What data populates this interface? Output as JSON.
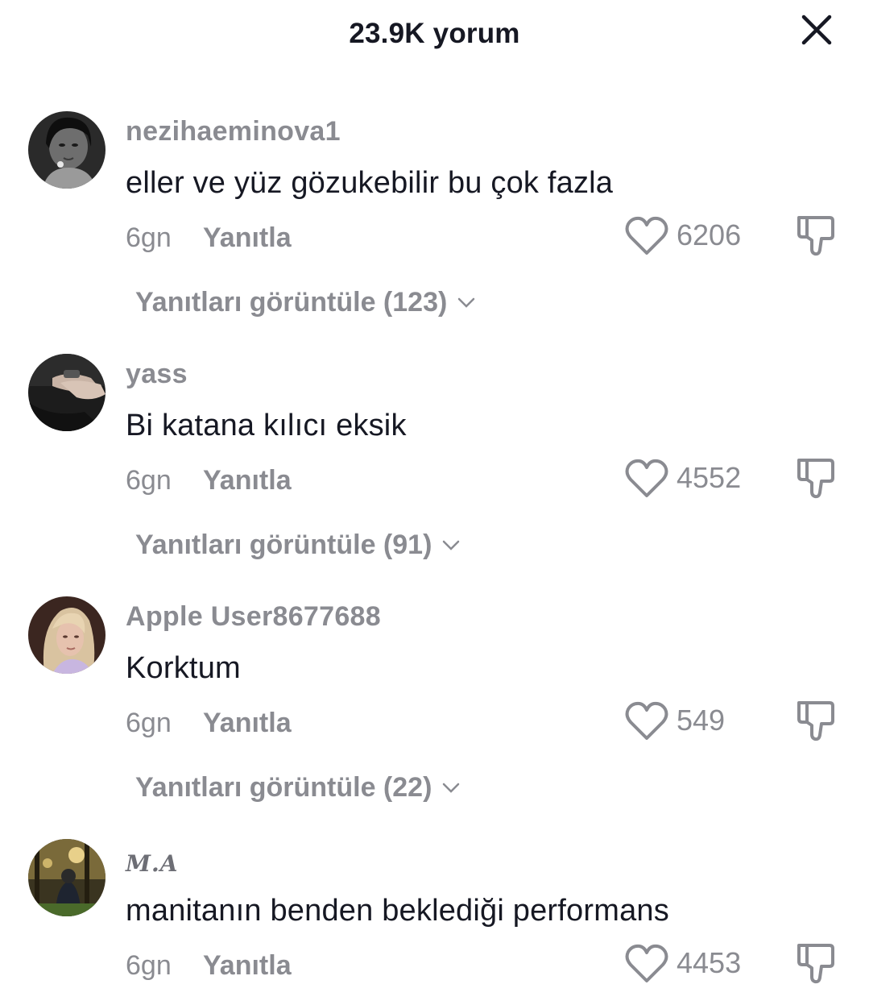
{
  "header": {
    "title": "23.9K yorum",
    "close_icon": "close-icon"
  },
  "colors": {
    "text_primary": "#161823",
    "text_secondary": "#8a8b91",
    "background": "#ffffff"
  },
  "comments": [
    {
      "username": "nezihaeminova1",
      "text": "eller ve yüz gözukebilir bu çok fazla",
      "time": "6gn",
      "reply_label": "Yanıtla",
      "likes": "6206",
      "view_replies": "Yanıtları görüntüle (123)"
    },
    {
      "username": "yass",
      "text": "Bi katana kılıcı eksik",
      "time": "6gn",
      "reply_label": "Yanıtla",
      "likes": "4552",
      "view_replies": "Yanıtları görüntüle (91)"
    },
    {
      "username": "Apple User8677688",
      "text": "Korktum",
      "time": "6gn",
      "reply_label": "Yanıtla",
      "likes": "549",
      "view_replies": "Yanıtları görüntüle (22)"
    },
    {
      "username": "M.A",
      "text": "manitanın benden beklediği performans",
      "time": "6gn",
      "reply_label": "Yanıtla",
      "likes": "4453"
    }
  ]
}
